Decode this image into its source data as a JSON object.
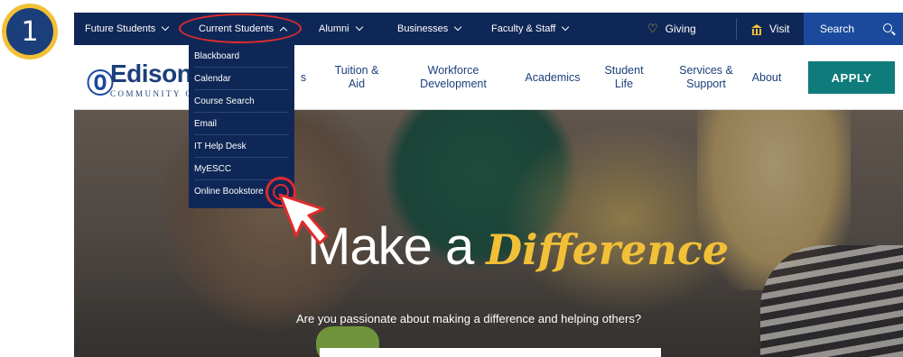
{
  "step": {
    "number": "1"
  },
  "utility_nav": {
    "items": [
      {
        "label": "Future Students"
      },
      {
        "label": "Current Students"
      },
      {
        "label": "Alumni"
      },
      {
        "label": "Businesses"
      },
      {
        "label": "Faculty & Staff"
      }
    ],
    "giving_label": "Giving",
    "visit_label": "Visit",
    "search_label": "Search"
  },
  "logo": {
    "name": "EdisonSt",
    "subtitle": "COMMUNITY C"
  },
  "main_nav": {
    "items": [
      {
        "label": "Tuition &\nAid"
      },
      {
        "label": "Workforce\nDevelopment"
      },
      {
        "label": "Academics"
      },
      {
        "label": "Student\nLife"
      },
      {
        "label": "Services &\nSupport"
      },
      {
        "label": "About"
      }
    ],
    "partial_label": "s",
    "apply_label": "APPLY"
  },
  "dropdown": {
    "items": [
      {
        "label": "Blackboard"
      },
      {
        "label": "Calendar"
      },
      {
        "label": "Course Search"
      },
      {
        "label": "Email"
      },
      {
        "label": "IT Help Desk"
      },
      {
        "label": "MyESCC"
      },
      {
        "label": "Online Bookstore"
      }
    ]
  },
  "hero": {
    "title_plain": "Make a",
    "title_script": "Difference",
    "subtitle": "Are you passionate about making a difference and helping others?"
  },
  "colors": {
    "nav_dark": "#0f2756",
    "search_blue": "#1b4a9c",
    "apply_teal": "#0e7c7b",
    "accent_gold": "#f2c037",
    "highlight_red": "#e02b2b"
  },
  "icons": {
    "giving": "heart-icon",
    "visit": "building-icon",
    "search": "search-icon"
  }
}
